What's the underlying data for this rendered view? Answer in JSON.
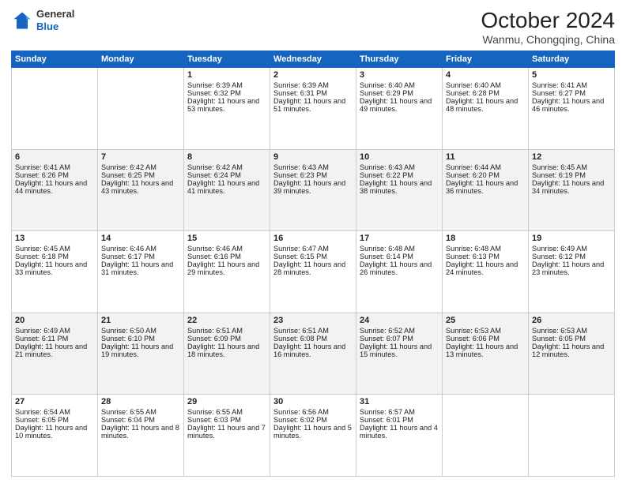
{
  "header": {
    "logo_general": "General",
    "logo_blue": "Blue",
    "month_year": "October 2024",
    "location": "Wanmu, Chongqing, China"
  },
  "days_of_week": [
    "Sunday",
    "Monday",
    "Tuesday",
    "Wednesday",
    "Thursday",
    "Friday",
    "Saturday"
  ],
  "weeks": [
    [
      {
        "day": "",
        "sunrise": "",
        "sunset": "",
        "daylight": ""
      },
      {
        "day": "",
        "sunrise": "",
        "sunset": "",
        "daylight": ""
      },
      {
        "day": "1",
        "sunrise": "Sunrise: 6:39 AM",
        "sunset": "Sunset: 6:32 PM",
        "daylight": "Daylight: 11 hours and 53 minutes."
      },
      {
        "day": "2",
        "sunrise": "Sunrise: 6:39 AM",
        "sunset": "Sunset: 6:31 PM",
        "daylight": "Daylight: 11 hours and 51 minutes."
      },
      {
        "day": "3",
        "sunrise": "Sunrise: 6:40 AM",
        "sunset": "Sunset: 6:29 PM",
        "daylight": "Daylight: 11 hours and 49 minutes."
      },
      {
        "day": "4",
        "sunrise": "Sunrise: 6:40 AM",
        "sunset": "Sunset: 6:28 PM",
        "daylight": "Daylight: 11 hours and 48 minutes."
      },
      {
        "day": "5",
        "sunrise": "Sunrise: 6:41 AM",
        "sunset": "Sunset: 6:27 PM",
        "daylight": "Daylight: 11 hours and 46 minutes."
      }
    ],
    [
      {
        "day": "6",
        "sunrise": "Sunrise: 6:41 AM",
        "sunset": "Sunset: 6:26 PM",
        "daylight": "Daylight: 11 hours and 44 minutes."
      },
      {
        "day": "7",
        "sunrise": "Sunrise: 6:42 AM",
        "sunset": "Sunset: 6:25 PM",
        "daylight": "Daylight: 11 hours and 43 minutes."
      },
      {
        "day": "8",
        "sunrise": "Sunrise: 6:42 AM",
        "sunset": "Sunset: 6:24 PM",
        "daylight": "Daylight: 11 hours and 41 minutes."
      },
      {
        "day": "9",
        "sunrise": "Sunrise: 6:43 AM",
        "sunset": "Sunset: 6:23 PM",
        "daylight": "Daylight: 11 hours and 39 minutes."
      },
      {
        "day": "10",
        "sunrise": "Sunrise: 6:43 AM",
        "sunset": "Sunset: 6:22 PM",
        "daylight": "Daylight: 11 hours and 38 minutes."
      },
      {
        "day": "11",
        "sunrise": "Sunrise: 6:44 AM",
        "sunset": "Sunset: 6:20 PM",
        "daylight": "Daylight: 11 hours and 36 minutes."
      },
      {
        "day": "12",
        "sunrise": "Sunrise: 6:45 AM",
        "sunset": "Sunset: 6:19 PM",
        "daylight": "Daylight: 11 hours and 34 minutes."
      }
    ],
    [
      {
        "day": "13",
        "sunrise": "Sunrise: 6:45 AM",
        "sunset": "Sunset: 6:18 PM",
        "daylight": "Daylight: 11 hours and 33 minutes."
      },
      {
        "day": "14",
        "sunrise": "Sunrise: 6:46 AM",
        "sunset": "Sunset: 6:17 PM",
        "daylight": "Daylight: 11 hours and 31 minutes."
      },
      {
        "day": "15",
        "sunrise": "Sunrise: 6:46 AM",
        "sunset": "Sunset: 6:16 PM",
        "daylight": "Daylight: 11 hours and 29 minutes."
      },
      {
        "day": "16",
        "sunrise": "Sunrise: 6:47 AM",
        "sunset": "Sunset: 6:15 PM",
        "daylight": "Daylight: 11 hours and 28 minutes."
      },
      {
        "day": "17",
        "sunrise": "Sunrise: 6:48 AM",
        "sunset": "Sunset: 6:14 PM",
        "daylight": "Daylight: 11 hours and 26 minutes."
      },
      {
        "day": "18",
        "sunrise": "Sunrise: 6:48 AM",
        "sunset": "Sunset: 6:13 PM",
        "daylight": "Daylight: 11 hours and 24 minutes."
      },
      {
        "day": "19",
        "sunrise": "Sunrise: 6:49 AM",
        "sunset": "Sunset: 6:12 PM",
        "daylight": "Daylight: 11 hours and 23 minutes."
      }
    ],
    [
      {
        "day": "20",
        "sunrise": "Sunrise: 6:49 AM",
        "sunset": "Sunset: 6:11 PM",
        "daylight": "Daylight: 11 hours and 21 minutes."
      },
      {
        "day": "21",
        "sunrise": "Sunrise: 6:50 AM",
        "sunset": "Sunset: 6:10 PM",
        "daylight": "Daylight: 11 hours and 19 minutes."
      },
      {
        "day": "22",
        "sunrise": "Sunrise: 6:51 AM",
        "sunset": "Sunset: 6:09 PM",
        "daylight": "Daylight: 11 hours and 18 minutes."
      },
      {
        "day": "23",
        "sunrise": "Sunrise: 6:51 AM",
        "sunset": "Sunset: 6:08 PM",
        "daylight": "Daylight: 11 hours and 16 minutes."
      },
      {
        "day": "24",
        "sunrise": "Sunrise: 6:52 AM",
        "sunset": "Sunset: 6:07 PM",
        "daylight": "Daylight: 11 hours and 15 minutes."
      },
      {
        "day": "25",
        "sunrise": "Sunrise: 6:53 AM",
        "sunset": "Sunset: 6:06 PM",
        "daylight": "Daylight: 11 hours and 13 minutes."
      },
      {
        "day": "26",
        "sunrise": "Sunrise: 6:53 AM",
        "sunset": "Sunset: 6:05 PM",
        "daylight": "Daylight: 11 hours and 12 minutes."
      }
    ],
    [
      {
        "day": "27",
        "sunrise": "Sunrise: 6:54 AM",
        "sunset": "Sunset: 6:05 PM",
        "daylight": "Daylight: 11 hours and 10 minutes."
      },
      {
        "day": "28",
        "sunrise": "Sunrise: 6:55 AM",
        "sunset": "Sunset: 6:04 PM",
        "daylight": "Daylight: 11 hours and 8 minutes."
      },
      {
        "day": "29",
        "sunrise": "Sunrise: 6:55 AM",
        "sunset": "Sunset: 6:03 PM",
        "daylight": "Daylight: 11 hours and 7 minutes."
      },
      {
        "day": "30",
        "sunrise": "Sunrise: 6:56 AM",
        "sunset": "Sunset: 6:02 PM",
        "daylight": "Daylight: 11 hours and 5 minutes."
      },
      {
        "day": "31",
        "sunrise": "Sunrise: 6:57 AM",
        "sunset": "Sunset: 6:01 PM",
        "daylight": "Daylight: 11 hours and 4 minutes."
      },
      {
        "day": "",
        "sunrise": "",
        "sunset": "",
        "daylight": ""
      },
      {
        "day": "",
        "sunrise": "",
        "sunset": "",
        "daylight": ""
      }
    ]
  ]
}
